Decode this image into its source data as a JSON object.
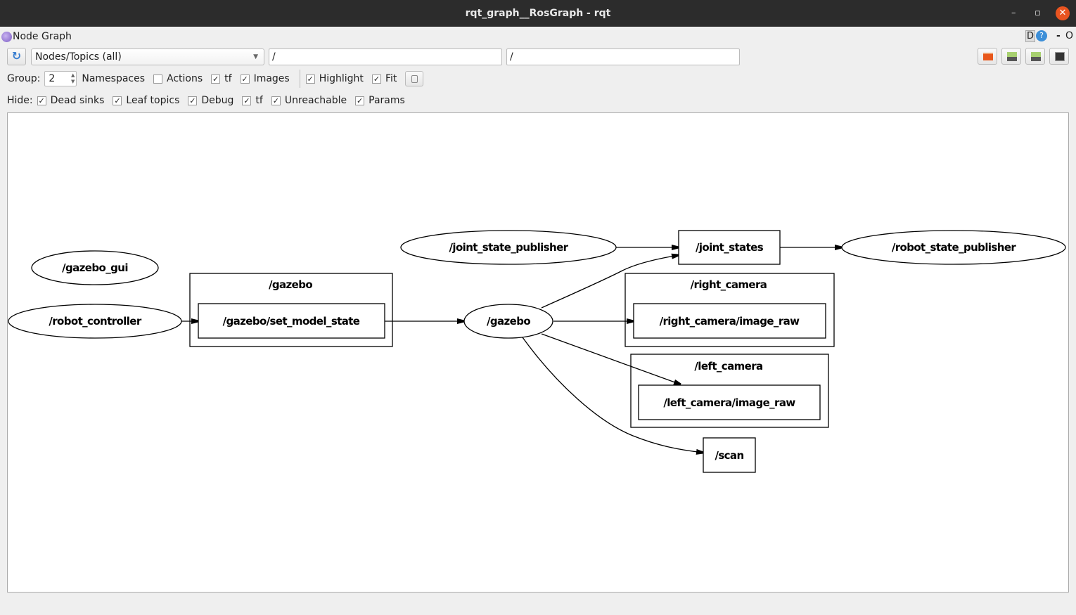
{
  "window": {
    "title": "rqt_graph__RosGraph - rqt",
    "minimize": "–",
    "restore": "▫",
    "close": "✕"
  },
  "plugin": {
    "title": "Node Graph",
    "d_label": "D",
    "help_label": "?",
    "dash": "-",
    "o_label": "O"
  },
  "toolbar": {
    "mode": "Nodes/Topics (all)",
    "node_filter": "/",
    "topic_filter": "/"
  },
  "options": {
    "group_label": "Group:",
    "group_value": "2",
    "items": [
      {
        "label": "Namespaces",
        "checked": null
      },
      {
        "label": "Actions",
        "checked": false
      },
      {
        "label": "tf",
        "checked": true
      },
      {
        "label": "Images",
        "checked": true
      }
    ],
    "items2": [
      {
        "label": "Highlight",
        "checked": true
      },
      {
        "label": "Fit",
        "checked": true
      }
    ]
  },
  "hide": {
    "label": "Hide:",
    "items": [
      {
        "label": "Dead sinks",
        "checked": true
      },
      {
        "label": "Leaf topics",
        "checked": true
      },
      {
        "label": "Debug",
        "checked": true
      },
      {
        "label": "tf",
        "checked": true
      },
      {
        "label": "Unreachable",
        "checked": true
      },
      {
        "label": "Params",
        "checked": true
      }
    ]
  },
  "graph": {
    "nodes": {
      "gazebo_gui": "/gazebo_gui",
      "robot_controller": "/robot_controller",
      "joint_state_publisher": "/joint_state_publisher",
      "gazebo": "/gazebo",
      "robot_state_publisher": "/robot_state_publisher"
    },
    "topics": {
      "set_model_state": "/gazebo/set_model_state",
      "joint_states": "/joint_states",
      "right_image_raw": "/right_camera/image_raw",
      "left_image_raw": "/left_camera/image_raw",
      "scan": "/scan"
    },
    "clusters": {
      "gazebo": "/gazebo",
      "right_camera": "/right_camera",
      "left_camera": "/left_camera"
    },
    "edges": [
      [
        "/robot_controller",
        "/gazebo/set_model_state"
      ],
      [
        "/gazebo/set_model_state",
        "/gazebo"
      ],
      [
        "/joint_state_publisher",
        "/joint_states"
      ],
      [
        "/joint_states",
        "/robot_state_publisher"
      ],
      [
        "/gazebo",
        "/joint_states"
      ],
      [
        "/gazebo",
        "/right_camera/image_raw"
      ],
      [
        "/gazebo",
        "/left_camera/image_raw"
      ],
      [
        "/gazebo",
        "/scan"
      ]
    ]
  }
}
